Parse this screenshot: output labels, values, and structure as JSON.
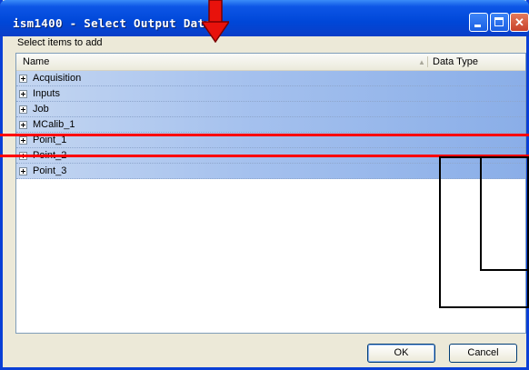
{
  "window": {
    "title": "ism1400 - Select Output Data",
    "colors": {
      "titlebar": "#0047d8",
      "selection": "#a5c1ee",
      "highlight": "#ff0000"
    }
  },
  "instruction": "Select items to add",
  "list": {
    "columns": {
      "name": "Name",
      "data_type": "Data Type"
    },
    "rows": [
      {
        "label": "Acquisition"
      },
      {
        "label": "Inputs"
      },
      {
        "label": "Job"
      },
      {
        "label": "MCalib_1"
      },
      {
        "label": "Point_1"
      },
      {
        "label": "Point_2"
      },
      {
        "label": "Point_3"
      }
    ]
  },
  "buttons": {
    "ok": "OK",
    "cancel": "Cancel"
  },
  "icons": {
    "minimize": "minimize-icon",
    "maximize": "maximize-icon",
    "close": "close-icon",
    "expand": "plus-expand-icon",
    "sort": "sort-ascending-icon",
    "arrow": "down-arrow-icon"
  }
}
